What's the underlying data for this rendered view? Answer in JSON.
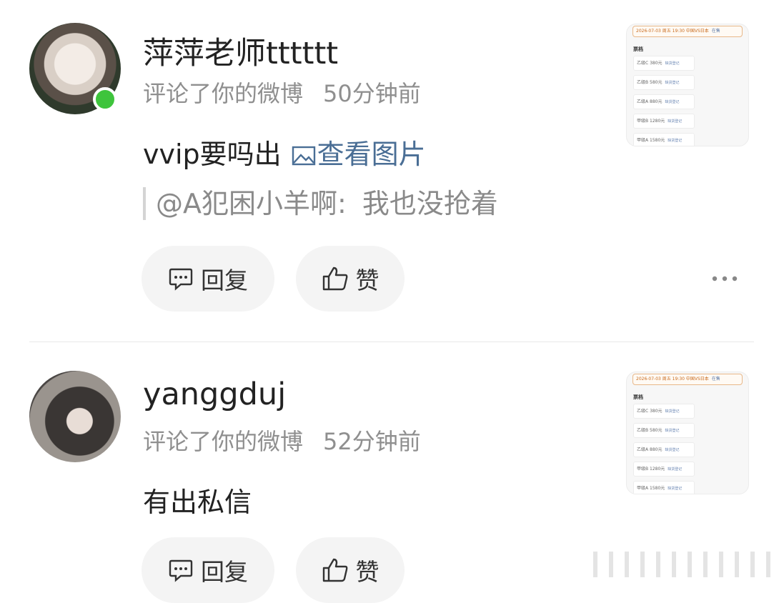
{
  "comments": [
    {
      "username": "萍萍老师tttttt",
      "action": "评论了你的微博",
      "time": "50分钟前",
      "content": "vvip要吗出",
      "view_image_label": "查看图片",
      "quote_user": "@A犯困小羊啊:",
      "quote_text": "我也没抢着",
      "reply_label": "回复",
      "like_label": "赞",
      "online": true,
      "thumbnail": {
        "banner": "2026-07-03 周五 19:30 中国VS日本",
        "banner_tag": "在售",
        "section": "票档",
        "rows": [
          {
            "label": "乙级C 380元",
            "tag": "缺货登记"
          },
          {
            "label": "乙级B 580元",
            "tag": "缺货登记"
          },
          {
            "label": "乙级A 880元",
            "tag": "缺货登记"
          },
          {
            "label": "甲级B 1280元",
            "tag": "缺货登记"
          },
          {
            "label": "甲级A 1580元",
            "tag": "缺货登记"
          }
        ]
      }
    },
    {
      "username": "yanggduj",
      "action": "评论了你的微博",
      "time": "52分钟前",
      "content": "有出私信",
      "reply_label": "回复",
      "like_label": "赞",
      "thumbnail": {
        "banner": "2026-07-03 周五 19:30 中国VS日本",
        "banner_tag": "在售",
        "section": "票档",
        "rows": [
          {
            "label": "乙级C 380元",
            "tag": "缺货登记"
          },
          {
            "label": "乙级B 580元",
            "tag": "缺货登记"
          },
          {
            "label": "乙级A 880元",
            "tag": "缺货登记"
          },
          {
            "label": "甲级B 1280元",
            "tag": "缺货登记"
          },
          {
            "label": "甲级A 1580元",
            "tag": "缺货登记"
          }
        ]
      }
    }
  ],
  "colors": {
    "link": "#4a6e95",
    "online": "#3ec43c",
    "meta": "#8f8f8f",
    "pill_bg": "#f4f4f4"
  },
  "icons": {
    "reply": "comment-bubble-icon",
    "like": "thumbs-up-icon",
    "more": "more-dots-icon",
    "view_image": "picture-icon"
  }
}
